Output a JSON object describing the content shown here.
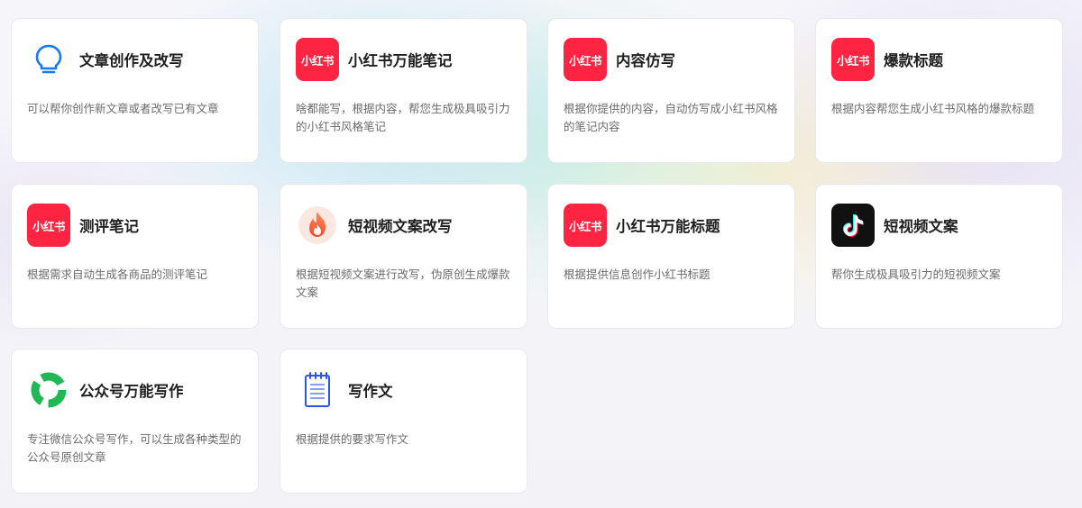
{
  "cards": [
    {
      "title": "文章创作及改写",
      "desc": "可以帮你创作新文章或者改写已有文章",
      "icon": "lightbulb-icon"
    },
    {
      "title": "小红书万能笔记",
      "desc": "啥都能写，根据内容，帮您生成极具吸引力的小红书风格笔记",
      "icon": "xiaohongshu-icon",
      "icon_text": "小红书"
    },
    {
      "title": "内容仿写",
      "desc": "根据你提供的内容，自动仿写成小红书风格的笔记内容",
      "icon": "xiaohongshu-icon",
      "icon_text": "小红书"
    },
    {
      "title": "爆款标题",
      "desc": "根据内容帮您生成小红书风格的爆款标题",
      "icon": "xiaohongshu-icon",
      "icon_text": "小红书"
    },
    {
      "title": "测评笔记",
      "desc": "根据需求自动生成各商品的测评笔记",
      "icon": "xiaohongshu-icon",
      "icon_text": "小红书"
    },
    {
      "title": "短视频文案改写",
      "desc": "根据短视频文案进行改写，伪原创生成爆款文案",
      "icon": "fire-icon"
    },
    {
      "title": "小红书万能标题",
      "desc": "根据提供信息创作小红书标题",
      "icon": "xiaohongshu-icon",
      "icon_text": "小红书"
    },
    {
      "title": "短视频文案",
      "desc": "帮你生成极具吸引力的短视频文案",
      "icon": "tiktok-icon"
    },
    {
      "title": "公众号万能写作",
      "desc": "专注微信公众号写作，可以生成各种类型的公众号原创文章",
      "icon": "wechat-official-icon"
    },
    {
      "title": "写作文",
      "desc": "根据提供的要求写作文",
      "icon": "notepad-icon"
    }
  ],
  "colors": {
    "xiaohongshu": "#ff2442",
    "tiktok_bg": "#111111",
    "wechat_green": "#1fb854",
    "lightbulb_blue": "#1677ff",
    "notepad_blue": "#2f54eb"
  }
}
